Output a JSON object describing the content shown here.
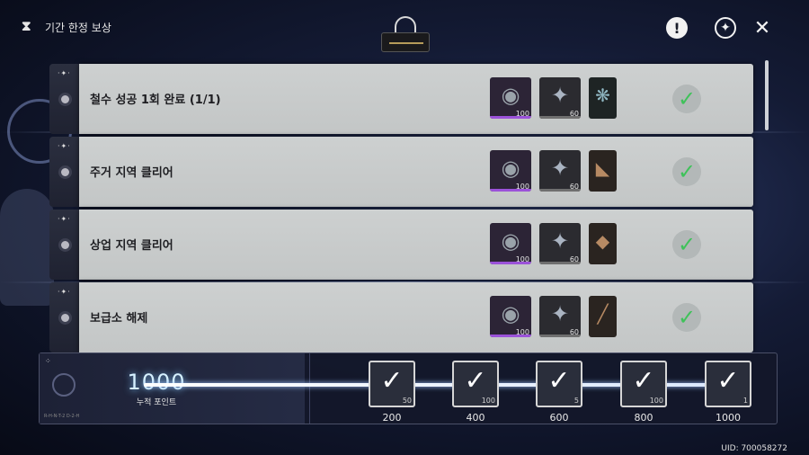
{
  "header": {
    "title": "기간 한정 보상",
    "mode_icon": "hourglass-icon",
    "actions": [
      {
        "name": "notice",
        "icon": "exclamation-icon",
        "glyph": "!"
      },
      {
        "name": "settings",
        "icon": "gear-icon",
        "glyph": "✦"
      },
      {
        "name": "close",
        "icon": "close-icon",
        "glyph": "✕"
      }
    ]
  },
  "quests": [
    {
      "title": "철수 성공 1회 완료 (1/1)",
      "completed": true,
      "rewards": [
        {
          "icon": "coin-icon",
          "glyph": "◉",
          "qty": "100"
        },
        {
          "icon": "star-shard-icon",
          "glyph": "✦",
          "qty": "60"
        },
        {
          "icon": "crystal-item-icon",
          "glyph": "❋",
          "qty": ""
        }
      ]
    },
    {
      "title": "주거 지역 클리어",
      "completed": true,
      "rewards": [
        {
          "icon": "coin-icon",
          "glyph": "◉",
          "qty": "100"
        },
        {
          "icon": "star-shard-icon",
          "glyph": "✦",
          "qty": "60"
        },
        {
          "icon": "leather-item-icon",
          "glyph": "◣",
          "qty": ""
        }
      ]
    },
    {
      "title": "상업 지역 클리어",
      "completed": true,
      "rewards": [
        {
          "icon": "coin-icon",
          "glyph": "◉",
          "qty": "100"
        },
        {
          "icon": "star-shard-icon",
          "glyph": "✦",
          "qty": "60"
        },
        {
          "icon": "pouch-item-icon",
          "glyph": "◆",
          "qty": ""
        }
      ]
    },
    {
      "title": "보급소 해제",
      "completed": true,
      "rewards": [
        {
          "icon": "coin-icon",
          "glyph": "◉",
          "qty": "100"
        },
        {
          "icon": "star-shard-icon",
          "glyph": "✦",
          "qty": "60"
        },
        {
          "icon": "rod-item-icon",
          "glyph": "╱",
          "qty": ""
        }
      ]
    }
  ],
  "progress": {
    "points": "1000",
    "points_label": "누적 포인트",
    "tiny_text": "R-H-N-T-2 D-2-H",
    "milestones": [
      {
        "threshold": "200",
        "qty": "50",
        "claimed": true
      },
      {
        "threshold": "400",
        "qty": "100",
        "claimed": true
      },
      {
        "threshold": "600",
        "qty": "5",
        "claimed": true
      },
      {
        "threshold": "800",
        "qty": "100",
        "claimed": true
      },
      {
        "threshold": "1000",
        "qty": "1",
        "claimed": true
      }
    ]
  },
  "uid": "UID: 700058272",
  "colors": {
    "check_green": "#3fc25a",
    "coin_rarity": "#9b52d9",
    "card_bg": "#c8cbcb",
    "points_glow": "#7fc9ff"
  }
}
